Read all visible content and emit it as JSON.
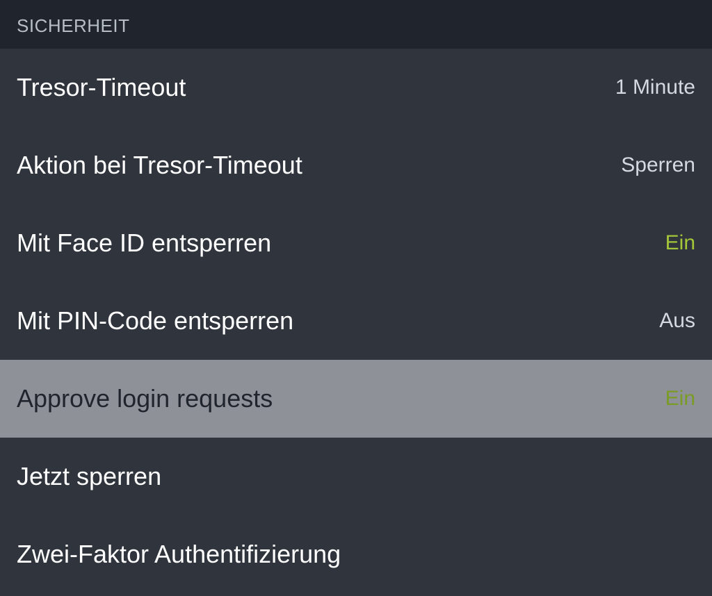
{
  "section": {
    "header": "SICHERHEIT"
  },
  "rows": {
    "vault_timeout": {
      "label": "Tresor-Timeout",
      "value": "1 Minute"
    },
    "vault_timeout_action": {
      "label": "Aktion bei Tresor-Timeout",
      "value": "Sperren"
    },
    "unlock_face_id": {
      "label": "Mit Face ID entsperren",
      "value": "Ein"
    },
    "unlock_pin": {
      "label": "Mit PIN-Code entsperren",
      "value": "Aus"
    },
    "approve_login": {
      "label": "Approve login requests",
      "value": "Ein"
    },
    "lock_now": {
      "label": "Jetzt sperren"
    },
    "two_factor": {
      "label": "Zwei-Faktor Authentifizierung"
    }
  }
}
